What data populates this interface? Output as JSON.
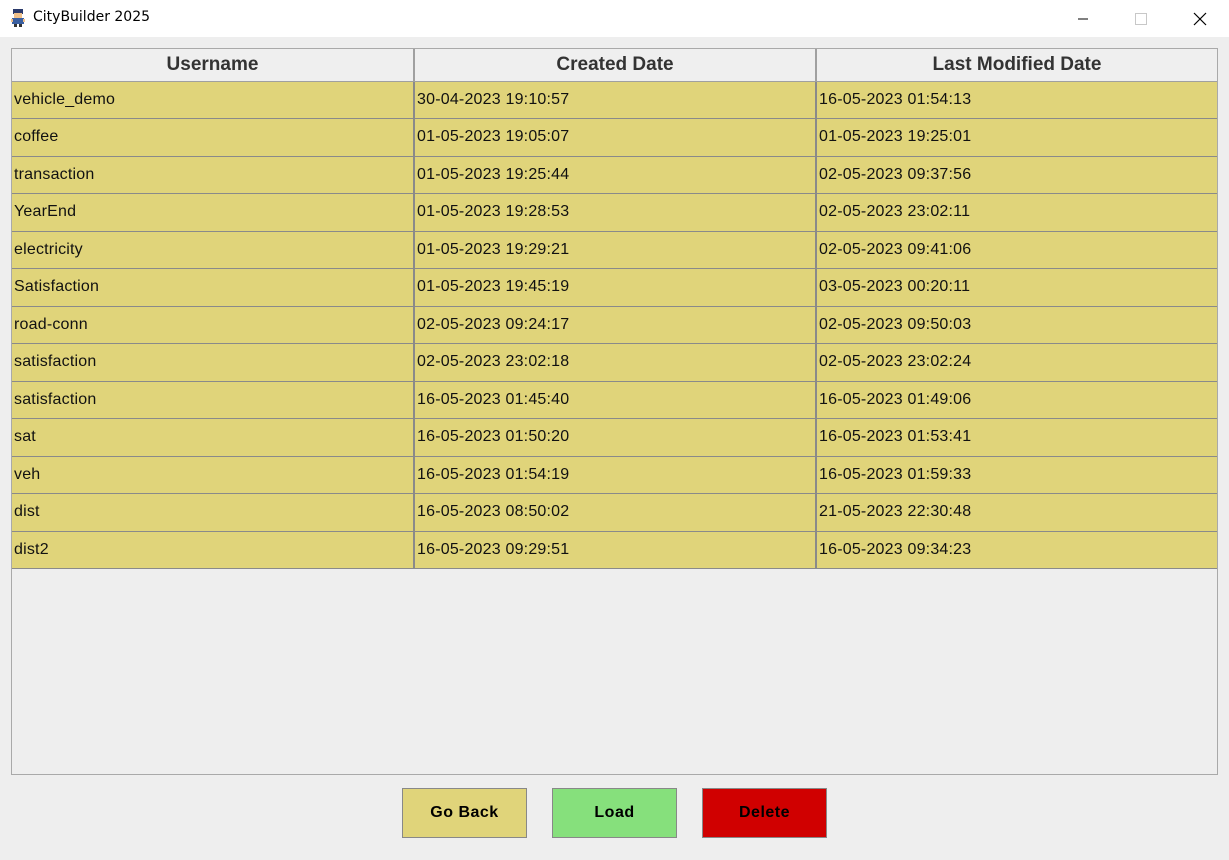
{
  "window": {
    "title": "CityBuilder 2025"
  },
  "table": {
    "headers": [
      "Username",
      "Created Date",
      "Last Modified Date"
    ],
    "rows": [
      [
        "vehicle_demo",
        "30-04-2023 19:10:57",
        "16-05-2023 01:54:13"
      ],
      [
        "coffee",
        "01-05-2023 19:05:07",
        "01-05-2023 19:25:01"
      ],
      [
        "transaction",
        "01-05-2023 19:25:44",
        "02-05-2023 09:37:56"
      ],
      [
        "YearEnd",
        "01-05-2023 19:28:53",
        "02-05-2023 23:02:11"
      ],
      [
        "electricity",
        "01-05-2023 19:29:21",
        "02-05-2023 09:41:06"
      ],
      [
        "Satisfaction",
        "01-05-2023 19:45:19",
        "03-05-2023 00:20:11"
      ],
      [
        "road-conn",
        "02-05-2023 09:24:17",
        "02-05-2023 09:50:03"
      ],
      [
        "satisfaction",
        "02-05-2023 23:02:18",
        "02-05-2023 23:02:24"
      ],
      [
        "satisfaction",
        "16-05-2023 01:45:40",
        "16-05-2023 01:49:06"
      ],
      [
        "sat",
        "16-05-2023 01:50:20",
        "16-05-2023 01:53:41"
      ],
      [
        "veh",
        "16-05-2023 01:54:19",
        "16-05-2023 01:59:33"
      ],
      [
        "dist",
        "16-05-2023 08:50:02",
        "21-05-2023 22:30:48"
      ],
      [
        "dist2",
        "16-05-2023 09:29:51",
        "16-05-2023 09:34:23"
      ]
    ]
  },
  "buttons": {
    "go_back": "Go Back",
    "load": "Load",
    "delete": "Delete"
  },
  "colors": {
    "row_bg": "#e0d47a",
    "go_back_bg": "#e0d47a",
    "load_bg": "#86e07c",
    "delete_bg": "#d00000"
  },
  "icons": {
    "app": "citybuilder-app-icon",
    "minimize": "minimize-icon",
    "maximize": "maximize-icon",
    "close": "close-icon"
  }
}
